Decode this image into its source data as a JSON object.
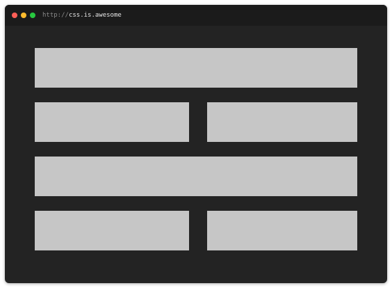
{
  "window": {
    "address_bar": {
      "protocol": "http://",
      "host": "css.is.awesome"
    },
    "controls": {
      "close_color": "#ff5f57",
      "minimize_color": "#febc2e",
      "maximize_color": "#28c840"
    }
  },
  "theme": {
    "background": "#232323",
    "titlebar": "#1b1b1b",
    "block": "#c6c6c6"
  },
  "content": {
    "blocks": [
      "block-1",
      "block-2",
      "block-3",
      "block-4",
      "block-5",
      "block-6"
    ]
  }
}
